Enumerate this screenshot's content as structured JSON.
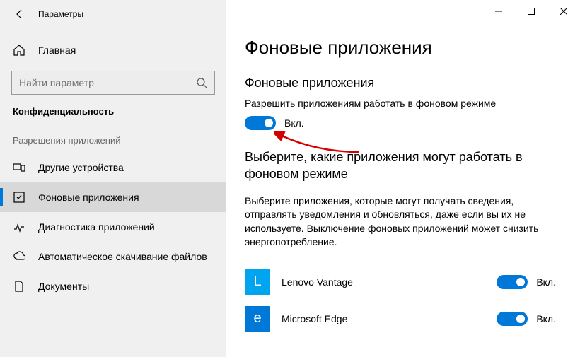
{
  "window": {
    "title": "Параметры"
  },
  "sidebar": {
    "home": "Главная",
    "search_placeholder": "Найти параметр",
    "category": "Конфиденциальность",
    "group_label": "Разрешения приложений",
    "items": [
      {
        "label": "Другие устройства"
      },
      {
        "label": "Фоновые приложения"
      },
      {
        "label": "Диагностика приложений"
      },
      {
        "label": "Автоматическое скачивание файлов"
      },
      {
        "label": "Документы"
      }
    ]
  },
  "main": {
    "title": "Фоновые приложения",
    "sub1": "Фоновые приложения",
    "sub1_desc": "Разрешить приложениям работать в фоновом режиме",
    "toggle_on": "Вкл.",
    "sub2": "Выберите, какие приложения могут работать в фоновом режиме",
    "sub2_desc": "Выберите приложения, которые могут получать сведения, отправлять уведомления и обновляться, даже если вы их не используете. Выключение фоновых приложений может снизить энергопотребление.",
    "apps": [
      {
        "name": "Lenovo Vantage",
        "state": "Вкл.",
        "icon_bg": "#00a4ef",
        "icon_letter": "L"
      },
      {
        "name": "Microsoft Edge",
        "state": "Вкл.",
        "icon_bg": "#0078d7",
        "icon_letter": "e"
      }
    ]
  }
}
